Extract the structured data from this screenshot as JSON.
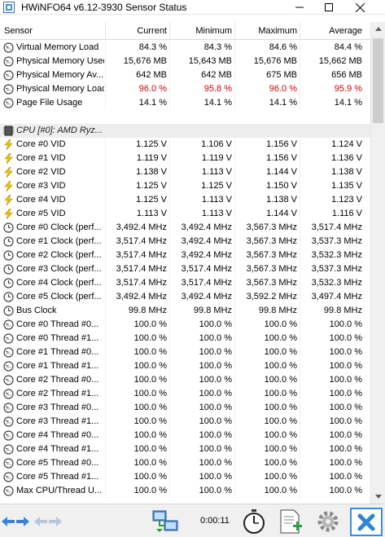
{
  "window": {
    "title": "HWiNFO64 v6.12-3930 Sensor Status"
  },
  "columns": {
    "sensor": "Sensor",
    "current": "Current",
    "minimum": "Minimum",
    "maximum": "Maximum",
    "average": "Average"
  },
  "rows": [
    {
      "type": "sensor",
      "icon": "gauge-icon",
      "name": "Virtual Memory Load",
      "current": "84.3 %",
      "minimum": "84.3 %",
      "maximum": "84.6 %",
      "average": "84.4 %"
    },
    {
      "type": "sensor",
      "icon": "gauge-icon",
      "name": "Physical Memory Used",
      "current": "15,676 MB",
      "minimum": "15,643 MB",
      "maximum": "15,676 MB",
      "average": "15,662 MB"
    },
    {
      "type": "sensor",
      "icon": "gauge-icon",
      "name": "Physical Memory Av...",
      "current": "642 MB",
      "minimum": "642 MB",
      "maximum": "675 MB",
      "average": "656 MB"
    },
    {
      "type": "sensor",
      "icon": "gauge-icon",
      "name": "Physical Memory Load",
      "current": "96.0 %",
      "minimum": "95.8 %",
      "maximum": "96.0 %",
      "average": "95.9 %",
      "alert": true
    },
    {
      "type": "sensor",
      "icon": "gauge-icon",
      "name": "Page File Usage",
      "current": "14.1 %",
      "minimum": "14.1 %",
      "maximum": "14.1 %",
      "average": "14.1 %"
    },
    {
      "type": "blank"
    },
    {
      "type": "group",
      "icon": "cpu-chip-icon",
      "name": "CPU [#0]: AMD Ryz..."
    },
    {
      "type": "sensor",
      "icon": "lightning-icon",
      "name": "Core #0 VID",
      "current": "1.125 V",
      "minimum": "1.106 V",
      "maximum": "1.156 V",
      "average": "1.124 V"
    },
    {
      "type": "sensor",
      "icon": "lightning-icon",
      "name": "Core #1 VID",
      "current": "1.119 V",
      "minimum": "1.119 V",
      "maximum": "1.156 V",
      "average": "1.136 V"
    },
    {
      "type": "sensor",
      "icon": "lightning-icon",
      "name": "Core #2 VID",
      "current": "1.138 V",
      "minimum": "1.113 V",
      "maximum": "1.144 V",
      "average": "1.138 V"
    },
    {
      "type": "sensor",
      "icon": "lightning-icon",
      "name": "Core #3 VID",
      "current": "1.125 V",
      "minimum": "1.125 V",
      "maximum": "1.150 V",
      "average": "1.135 V"
    },
    {
      "type": "sensor",
      "icon": "lightning-icon",
      "name": "Core #4 VID",
      "current": "1.125 V",
      "minimum": "1.113 V",
      "maximum": "1.138 V",
      "average": "1.123 V"
    },
    {
      "type": "sensor",
      "icon": "lightning-icon",
      "name": "Core #5 VID",
      "current": "1.113 V",
      "minimum": "1.113 V",
      "maximum": "1.144 V",
      "average": "1.116 V"
    },
    {
      "type": "sensor",
      "icon": "clock-icon",
      "name": "Core #0 Clock (perf...",
      "current": "3,492.4 MHz",
      "minimum": "3,492.4 MHz",
      "maximum": "3,567.3 MHz",
      "average": "3,517.4 MHz"
    },
    {
      "type": "sensor",
      "icon": "clock-icon",
      "name": "Core #1 Clock (perf...",
      "current": "3,517.4 MHz",
      "minimum": "3,492.4 MHz",
      "maximum": "3,567.3 MHz",
      "average": "3,537.3 MHz"
    },
    {
      "type": "sensor",
      "icon": "clock-icon",
      "name": "Core #2 Clock (perf...",
      "current": "3,517.4 MHz",
      "minimum": "3,492.4 MHz",
      "maximum": "3,567.3 MHz",
      "average": "3,532.3 MHz"
    },
    {
      "type": "sensor",
      "icon": "clock-icon",
      "name": "Core #3 Clock (perf...",
      "current": "3,517.4 MHz",
      "minimum": "3,517.4 MHz",
      "maximum": "3,567.3 MHz",
      "average": "3,537.3 MHz"
    },
    {
      "type": "sensor",
      "icon": "clock-icon",
      "name": "Core #4 Clock (perf...",
      "current": "3,517.4 MHz",
      "minimum": "3,517.4 MHz",
      "maximum": "3,567.3 MHz",
      "average": "3,532.3 MHz"
    },
    {
      "type": "sensor",
      "icon": "clock-icon",
      "name": "Core #5 Clock (perf...",
      "current": "3,492.4 MHz",
      "minimum": "3,492.4 MHz",
      "maximum": "3,592.2 MHz",
      "average": "3,497.4 MHz"
    },
    {
      "type": "sensor",
      "icon": "clock-icon",
      "name": "Bus Clock",
      "current": "99.8 MHz",
      "minimum": "99.8 MHz",
      "maximum": "99.8 MHz",
      "average": "99.8 MHz"
    },
    {
      "type": "sensor",
      "icon": "gauge-icon",
      "name": "Core #0 Thread #0...",
      "current": "100.0 %",
      "minimum": "100.0 %",
      "maximum": "100.0 %",
      "average": "100.0 %"
    },
    {
      "type": "sensor",
      "icon": "gauge-icon",
      "name": "Core #0 Thread #1...",
      "current": "100.0 %",
      "minimum": "100.0 %",
      "maximum": "100.0 %",
      "average": "100.0 %"
    },
    {
      "type": "sensor",
      "icon": "gauge-icon",
      "name": "Core #1 Thread #0...",
      "current": "100.0 %",
      "minimum": "100.0 %",
      "maximum": "100.0 %",
      "average": "100.0 %"
    },
    {
      "type": "sensor",
      "icon": "gauge-icon",
      "name": "Core #1 Thread #1...",
      "current": "100.0 %",
      "minimum": "100.0 %",
      "maximum": "100.0 %",
      "average": "100.0 %"
    },
    {
      "type": "sensor",
      "icon": "gauge-icon",
      "name": "Core #2 Thread #0...",
      "current": "100.0 %",
      "minimum": "100.0 %",
      "maximum": "100.0 %",
      "average": "100.0 %"
    },
    {
      "type": "sensor",
      "icon": "gauge-icon",
      "name": "Core #2 Thread #1...",
      "current": "100.0 %",
      "minimum": "100.0 %",
      "maximum": "100.0 %",
      "average": "100.0 %"
    },
    {
      "type": "sensor",
      "icon": "gauge-icon",
      "name": "Core #3 Thread #0...",
      "current": "100.0 %",
      "minimum": "100.0 %",
      "maximum": "100.0 %",
      "average": "100.0 %"
    },
    {
      "type": "sensor",
      "icon": "gauge-icon",
      "name": "Core #3 Thread #1...",
      "current": "100.0 %",
      "minimum": "100.0 %",
      "maximum": "100.0 %",
      "average": "100.0 %"
    },
    {
      "type": "sensor",
      "icon": "gauge-icon",
      "name": "Core #4 Thread #0...",
      "current": "100.0 %",
      "minimum": "100.0 %",
      "maximum": "100.0 %",
      "average": "100.0 %"
    },
    {
      "type": "sensor",
      "icon": "gauge-icon",
      "name": "Core #4 Thread #1...",
      "current": "100.0 %",
      "minimum": "100.0 %",
      "maximum": "100.0 %",
      "average": "100.0 %"
    },
    {
      "type": "sensor",
      "icon": "gauge-icon",
      "name": "Core #5 Thread #0...",
      "current": "100.0 %",
      "minimum": "100.0 %",
      "maximum": "100.0 %",
      "average": "100.0 %"
    },
    {
      "type": "sensor",
      "icon": "gauge-icon",
      "name": "Core #5 Thread #1...",
      "current": "100.0 %",
      "minimum": "100.0 %",
      "maximum": "100.0 %",
      "average": "100.0 %"
    },
    {
      "type": "sensor",
      "icon": "gauge-icon",
      "name": "Max CPU/Thread U...",
      "current": "100.0 %",
      "minimum": "100.0 %",
      "maximum": "100.0 %",
      "average": "100.0 %"
    }
  ],
  "toolbar": {
    "elapsed_time": "0:00:11"
  },
  "colors": {
    "alert_text": "#d40000",
    "accent_blue": "#3c8ee0",
    "toolbar_bg": "#f0f0f0"
  }
}
